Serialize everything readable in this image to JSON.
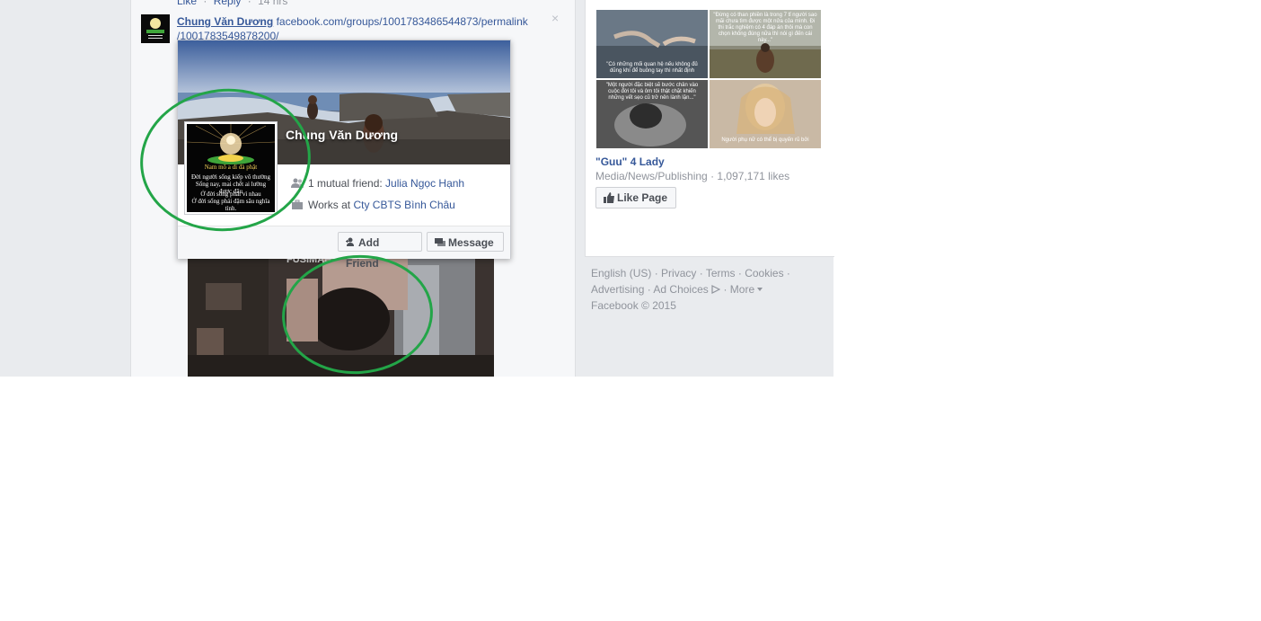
{
  "comment_prev": {
    "like_label": "Like",
    "reply_label": "Reply",
    "separator": "·",
    "time": "14 hrs"
  },
  "comment": {
    "author": "Chung Văn Dương",
    "link_line1": "facebook.com/groups/1001783486544873/permalink",
    "link_line2": "/1001783549878200/",
    "close_icon": "×"
  },
  "hover_card": {
    "name": "Chung Văn Dương",
    "mutual_prefix": "1 mutual friend: ",
    "mutual_friend": "Julia Ngọc Hạnh",
    "works_prefix": "Works at ",
    "workplace": "Cty CBTS Bình Châu",
    "add_friend_label": "Add Friend",
    "message_label": "Message",
    "profile_pic_lines": [
      "Nam mô a di đà phật",
      "Đời người sống kiếp vô thường",
      "Sống nay, mai chết ai lường được đâu",
      "Ở đời sống phải vì nhau",
      "Ở đời sống phải đậm sâu nghĩa tình."
    ]
  },
  "post_image": {
    "watermark": "FUSIMAH"
  },
  "page_suggestion": {
    "image_captions": [
      "\"Có những mối quan hệ nếu không đủ dũng khí để buông tay thì nhất định",
      "\"Đừng có than phiền là trong 7 tỉ người sao mãi chưa tìm được một nửa của mình. Đi thi trắc nghiệm có 4 đáp án thôi mà con chọn không đúng nữa thì nói gì đến cái này...\"",
      "\"Một người đặc biệt sẽ bước chân vào cuộc đời tôi và ôm tôi thật chặt khiến những vết sẹo cũ trở nên lành lặn...\"",
      "Người phụ nữ có thể bị quyến rũ bởi"
    ],
    "page_name": "\"Guu\" 4 Lady",
    "category": "Media/News/Publishing",
    "separator": "·",
    "likes": "1,097,171 likes",
    "like_button": "Like Page"
  },
  "footer": {
    "links": [
      "English (US)",
      "Privacy",
      "Terms",
      "Cookies",
      "Advertising",
      "Ad Choices",
      "More"
    ],
    "separator": "·",
    "copyright": "Facebook © 2015"
  },
  "colors": {
    "link": "#365899",
    "highlight_circle": "#23a548",
    "page_bg": "#e9ebee"
  },
  "icons": [
    "close-icon",
    "mutual-friends-icon",
    "briefcase-icon",
    "add-friend-icon",
    "message-icon",
    "thumbs-up-icon",
    "ad-choices-icon",
    "caret-down-icon"
  ]
}
